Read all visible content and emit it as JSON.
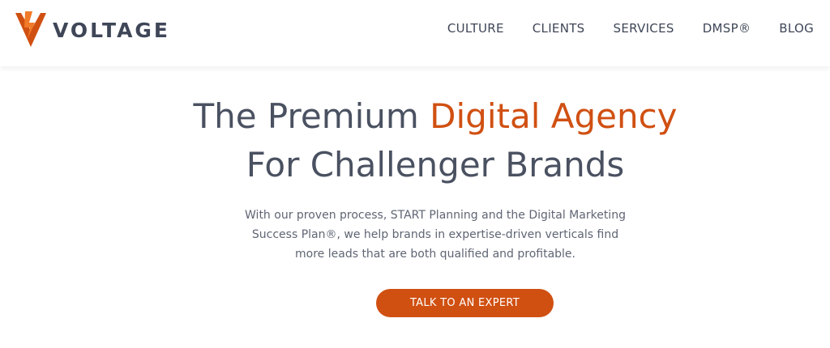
{
  "brand": {
    "name": "VOLTAGE",
    "logo_icon": "voltage-v-bolt-logo",
    "accent_color": "#d05012",
    "text_color": "#3f4658"
  },
  "nav": {
    "items": [
      {
        "label": "CULTURE"
      },
      {
        "label": "CLIENTS"
      },
      {
        "label": "SERVICES"
      },
      {
        "label": "DMSP®"
      },
      {
        "label": "BLOG"
      }
    ]
  },
  "hero": {
    "title_part1": "The Premium ",
    "title_accent": "Digital Agency",
    "title_line2": "For Challenger Brands",
    "desc_line1": "With our proven process, START Planning and the Digital Marketing",
    "desc_line2": "Success Plan®, we help brands in expertise-driven verticals find",
    "desc_line3": "more leads that are both qualified and profitable.",
    "cta_label": "TALK TO AN EXPERT"
  }
}
